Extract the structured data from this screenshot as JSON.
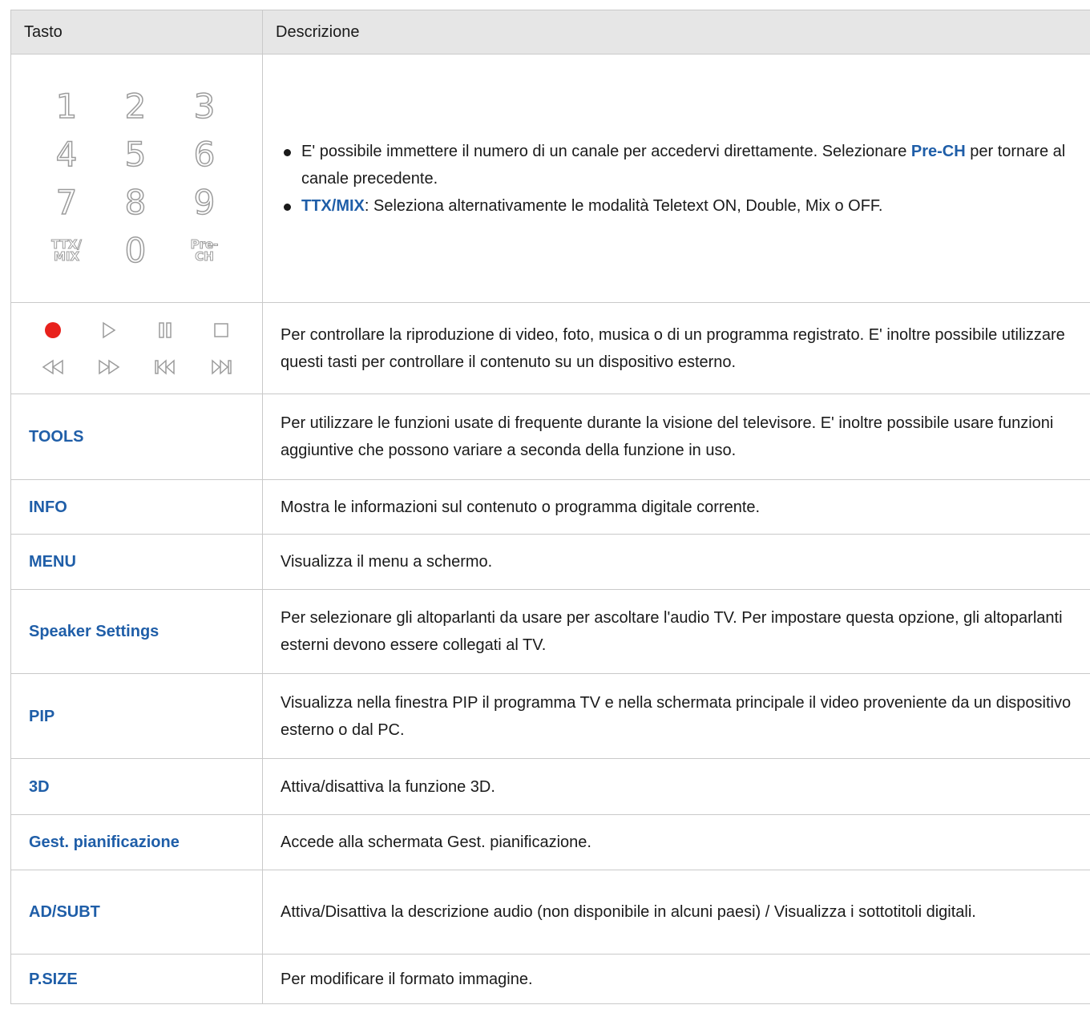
{
  "header": {
    "col_key": "Tasto",
    "col_desc": "Descrizione"
  },
  "numpad": {
    "digits": [
      "1",
      "2",
      "3",
      "4",
      "5",
      "6",
      "7",
      "8",
      "9"
    ],
    "ttx_top": "TTX/",
    "ttx_bottom": "MIX",
    "zero": "0",
    "prech_top": "Pre-",
    "prech_bottom": "CH",
    "bullet1_text": "E' possibile immettere il numero di un canale per accedervi direttamente. Selezionare ",
    "bullet1_key": "Pre-CH",
    "bullet1_tail": " per tornare al canale precedente.",
    "bullet2_key": "TTX/MIX",
    "bullet2_text": ": Seleziona alternativamente le modalità Teletext ON, Double, Mix o OFF."
  },
  "media": {
    "icons": [
      "record-icon",
      "play-icon",
      "pause-icon",
      "stop-icon",
      "rewind-icon",
      "fast-forward-icon",
      "skip-back-icon",
      "skip-forward-icon"
    ],
    "record_color": "#e8211c",
    "desc": "Per controllare la riproduzione di video, foto, musica o di un programma registrato. E' inoltre possibile utilizzare questi tasti per controllare il contenuto su un dispositivo esterno."
  },
  "rows": [
    {
      "key": "TOOLS",
      "desc": "Per utilizzare le funzioni usate di frequente durante la visione del televisore. E' inoltre possibile usare funzioni aggiuntive che possono variare a seconda della funzione in uso."
    },
    {
      "key": "INFO",
      "desc": "Mostra le informazioni sul contenuto o programma digitale corrente."
    },
    {
      "key": "MENU",
      "desc": "Visualizza il menu a schermo."
    },
    {
      "key": "Speaker Settings",
      "desc": "Per selezionare gli altoparlanti da usare per ascoltare l'audio TV. Per impostare questa opzione, gli altoparlanti esterni devono essere collegati al TV."
    },
    {
      "key": "PIP",
      "desc": "Visualizza nella finestra PIP il programma TV e nella schermata principale il video proveniente da un dispositivo esterno o dal PC."
    },
    {
      "key": "3D",
      "desc": "Attiva/disattiva la funzione 3D."
    },
    {
      "key": "Gest. pianificazione",
      "desc": "Accede alla schermata Gest. pianificazione."
    },
    {
      "key": "AD/SUBT",
      "desc": "Attiva/Disattiva la descrizione audio (non disponibile in alcuni paesi)  / Visualizza i sottotitoli digitali."
    },
    {
      "key": "P.SIZE",
      "desc": "Per modificare il formato immagine."
    }
  ],
  "colors": {
    "accent": "#1f5ea8",
    "header_bg": "#e6e6e6",
    "rule": "#c9c9c9"
  }
}
